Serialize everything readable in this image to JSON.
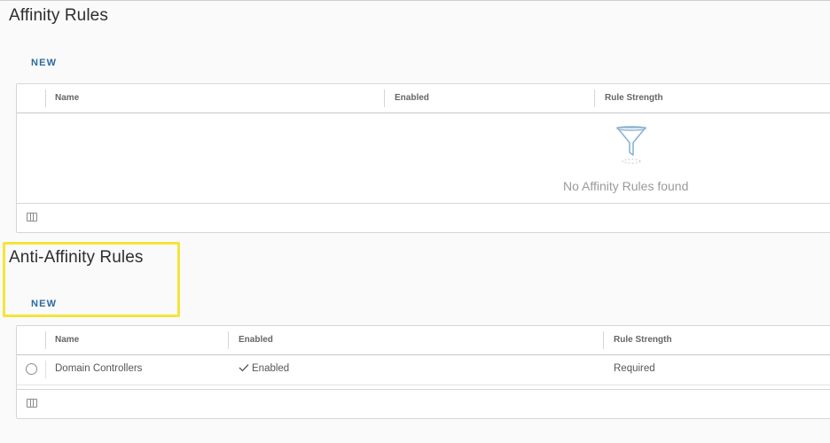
{
  "affinity": {
    "title": "Affinity Rules",
    "new_label": "NEW",
    "columns": [
      "Name",
      "Enabled",
      "Rule Strength"
    ],
    "empty_message": "No Affinity Rules found",
    "empty_icon": "funnel-filter-icon"
  },
  "anti_affinity": {
    "title": "Anti-Affinity Rules",
    "new_label": "NEW",
    "columns": [
      "Name",
      "Enabled",
      "Rule Strength"
    ],
    "rows": [
      {
        "name": "Domain Controllers",
        "enabled": "Enabled",
        "strength": "Required"
      }
    ],
    "highlight_color": "#f4e43b"
  },
  "colors": {
    "accent": "#2c6aa0",
    "background": "#fafafa",
    "border": "#d6d6d6"
  }
}
